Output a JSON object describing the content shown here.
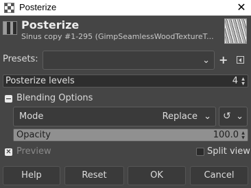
{
  "window": {
    "title": "Posterize"
  },
  "header": {
    "title": "Posterize",
    "subtitle": "Sinus copy #1-295 (GimpSeamlessWoodTextureT..."
  },
  "presets": {
    "label": "Presets:",
    "value": ""
  },
  "posterize": {
    "label": "Posterize levels",
    "value": "4"
  },
  "blending": {
    "label": "Blending Options",
    "expanded": true,
    "mode_label": "Mode",
    "mode_value": "Replace",
    "opacity_label": "Opacity",
    "opacity_value": "100.0",
    "opacity_fraction": 1.0
  },
  "preview": {
    "label": "Preview",
    "checked": true,
    "split_label": "Split view",
    "split_checked": false
  },
  "buttons": {
    "help": "Help",
    "reset": "Reset",
    "ok": "OK",
    "cancel": "Cancel"
  },
  "icons": {
    "window": "posterize-icon",
    "close": "close-icon",
    "header": "posterize-icon",
    "thumbnail": "layer-thumbnail",
    "add_preset": "plus-icon",
    "preset_menu": "menu-icon",
    "mode_switch": "swirl-icon",
    "dropdown": "chevron-down-icon"
  },
  "colors": {
    "dialog_bg": "#454545",
    "titlebar_bg": "#ffffff",
    "field_bg": "#2e2e2e",
    "opacity_bar": "#909090"
  }
}
